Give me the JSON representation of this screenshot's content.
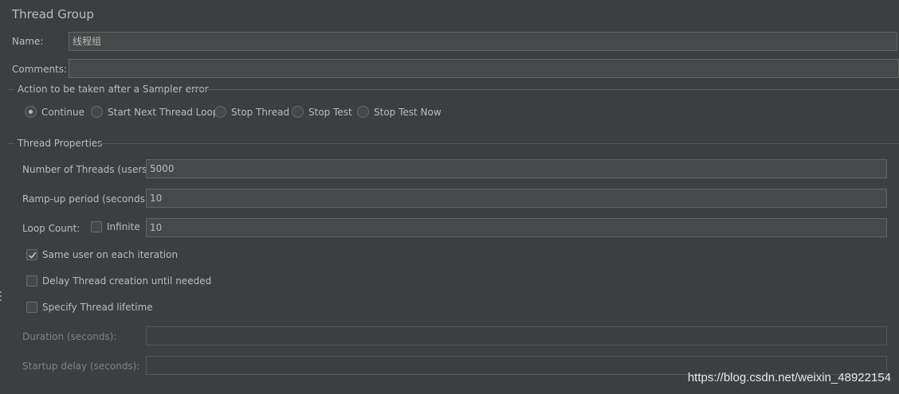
{
  "title": "Thread Group",
  "name": {
    "label": "Name:",
    "value": "线程组"
  },
  "comments": {
    "label": "Comments:",
    "value": ""
  },
  "sampler_error": {
    "title": "Action to be taken after a Sampler error",
    "options": [
      "Continue",
      "Start Next Thread Loop",
      "Stop Thread",
      "Stop Test",
      "Stop Test Now"
    ],
    "selected": "Continue"
  },
  "thread_properties": {
    "title": "Thread Properties",
    "num_threads": {
      "label": "Number of Threads (users):",
      "value": "5000"
    },
    "ramp_up": {
      "label": "Ramp-up period (seconds):",
      "value": "10"
    },
    "loop_count": {
      "label": "Loop Count:",
      "infinite_label": "Infinite",
      "infinite_checked": false,
      "value": "10"
    },
    "same_user": {
      "label": "Same user on each iteration",
      "checked": true
    },
    "delay_creation": {
      "label": "Delay Thread creation until needed",
      "checked": false
    },
    "specify_lifetime": {
      "label": "Specify Thread lifetime",
      "checked": false
    },
    "duration": {
      "label": "Duration (seconds):",
      "value": ""
    },
    "startup_delay": {
      "label": "Startup delay (seconds):",
      "value": ""
    }
  },
  "watermark": "https://blog.csdn.net/weixin_48922154",
  "colors": {
    "background": "#3c3f41",
    "field": "#45494a",
    "text": "#bbbbbb",
    "border": "#646464"
  }
}
